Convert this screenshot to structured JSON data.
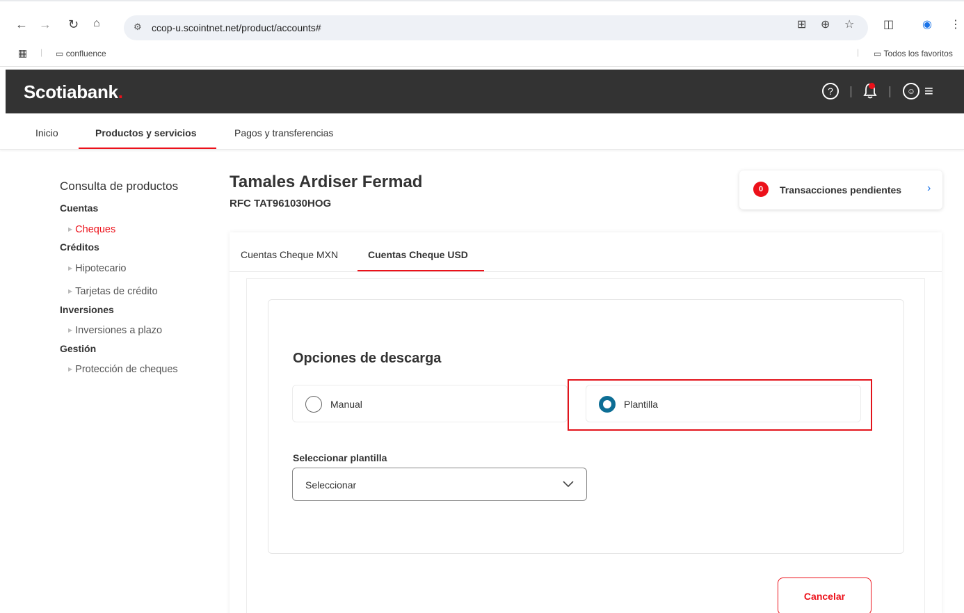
{
  "browser": {
    "url": "ccop-u.scointnet.net/product/accounts#",
    "bookmark_folder": "confluence",
    "all_bookmarks": "Todos los favoritos"
  },
  "header": {
    "logo_text": "Scotiabank",
    "logo_dot": ".",
    "notification_count": "0",
    "icons": [
      "help-icon",
      "bell-icon",
      "user-icon",
      "menu-icon"
    ]
  },
  "nav": {
    "items": [
      {
        "label": "Inicio",
        "active": false
      },
      {
        "label": "Productos y servicios",
        "active": true
      },
      {
        "label": "Pagos y transferencias",
        "active": false
      }
    ]
  },
  "sidebar": {
    "title": "Consulta de productos",
    "groups": [
      {
        "label": "Cuentas",
        "items": [
          {
            "label": "Cheques",
            "active": true
          }
        ]
      },
      {
        "label": "Créditos",
        "items": [
          {
            "label": "Hipotecario"
          },
          {
            "label": "Tarjetas de crédito"
          }
        ]
      },
      {
        "label": "Inversiones",
        "items": [
          {
            "label": "Inversiones a plazo"
          }
        ]
      },
      {
        "label": "Gestión",
        "items": [
          {
            "label": "Protección de cheques"
          }
        ]
      }
    ]
  },
  "account": {
    "name": "Tamales Ardiser Fermad",
    "rfc": "RFC TAT961030HOG"
  },
  "pending": {
    "count": "0",
    "label": "Transacciones pendientes"
  },
  "tabs": [
    {
      "label": "Cuentas Cheque MXN",
      "active": false
    },
    {
      "label": "Cuentas Cheque USD",
      "active": true
    }
  ],
  "download": {
    "title": "Opciones de descarga",
    "options": [
      {
        "label": "Manual",
        "selected": false
      },
      {
        "label": "Plantilla",
        "selected": true
      }
    ],
    "select_label": "Seleccionar plantilla",
    "select_value": "Seleccionar"
  },
  "actions": {
    "cancel_label": "Cancelar"
  },
  "colors": {
    "brand_red": "#ec111a",
    "header_bg": "#333333",
    "radio_selected": "#0d6e95",
    "highlight": "#e3131b"
  }
}
